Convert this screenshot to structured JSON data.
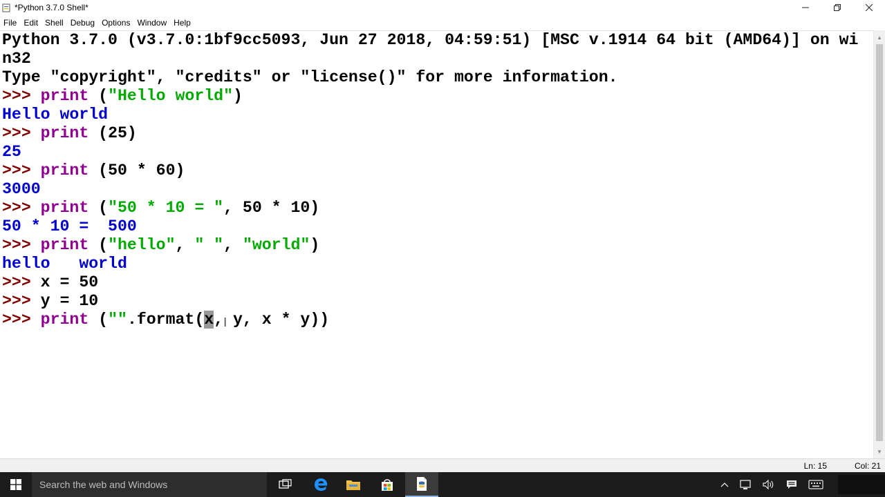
{
  "window": {
    "title": "*Python 3.7.0 Shell*",
    "controls": {
      "minimize": "—",
      "maximize": "❐",
      "close": "✕"
    }
  },
  "menu": [
    "File",
    "Edit",
    "Shell",
    "Debug",
    "Options",
    "Window",
    "Help"
  ],
  "shell": {
    "banner_line1": "Python 3.7.0 (v3.7.0:1bf9cc5093, Jun 27 2018, 04:59:51) [MSC v.1914 64 bit (AMD64)] on wi",
    "banner_line2": "n32",
    "banner_line3": "Type \"copyright\", \"credits\" or \"license()\" for more information.",
    "prompt": ">>> ",
    "kw_print": "print",
    "cmd1_a": " (",
    "cmd1_str": "\"Hello world\"",
    "cmd1_b": ")",
    "out1": "Hello world",
    "cmd2_a": " (25)",
    "out2": "25",
    "cmd3_a": " (50 * 60)",
    "out3": "3000",
    "cmd4_a": " (",
    "cmd4_str": "\"50 * 10 = \"",
    "cmd4_b": ", 50 * 10)",
    "out4": "50 * 10 =  500",
    "cmd5_a": " (",
    "cmd5_str1": "\"hello\"",
    "cmd5_sep1": ", ",
    "cmd5_str2": "\" \"",
    "cmd5_sep2": ", ",
    "cmd5_str3": "\"world\"",
    "cmd5_b": ")",
    "out5": "hello   world",
    "cmd6": "x = 50",
    "cmd7": "y = 10",
    "cmd8_a": " (",
    "cmd8_str": "\"\"",
    "cmd8_b": ".format(",
    "cmd8_sel": "x",
    "cmd8_c": ", y, x * y))"
  },
  "status": {
    "line": "Ln: 15",
    "col": "Col: 21"
  },
  "taskbar": {
    "search_placeholder": "Search the web and Windows",
    "colors": {
      "background": "#1c1c1c",
      "search": "#2d2d2d",
      "edge": "#1e90ff",
      "explorer": "#f2c14e"
    },
    "icons": [
      "windows-start-icon",
      "task-view-icon",
      "edge-icon",
      "file-explorer-icon",
      "store-icon",
      "python-idle-icon"
    ],
    "tray_icons": [
      "chevron-up-icon",
      "network-icon",
      "volume-icon",
      "notification-icon",
      "keyboard-icon"
    ]
  }
}
